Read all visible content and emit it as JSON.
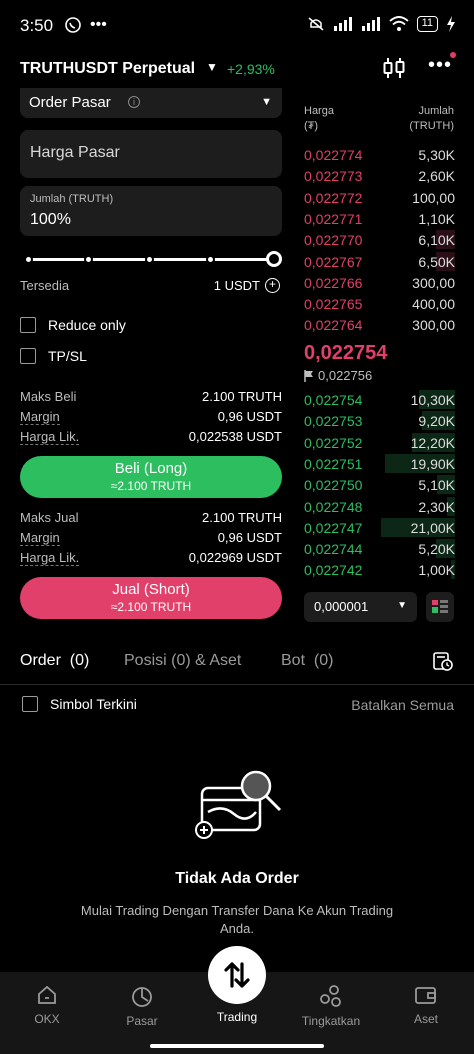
{
  "status_bar": {
    "time": "3:50",
    "battery": "11"
  },
  "header": {
    "pair": "TRUTHUSDT Perpetual",
    "change": "+2,93%"
  },
  "form": {
    "order_type": "Order Pasar",
    "price_placeholder": "Harga Pasar",
    "amount_label": "Jumlah (TRUTH)",
    "amount_value": "100%",
    "available_label": "Tersedia",
    "available_value": "1 USDT",
    "reduce_only": "Reduce only",
    "tpsl": "TP/SL",
    "buy_info": {
      "max_label": "Maks Beli",
      "max_value": "2.100 TRUTH",
      "margin_label": "Margin",
      "margin_value": "0,96 USDT",
      "liq_label": "Harga Lik.",
      "liq_value": "0,022538 USDT"
    },
    "buy_button": {
      "label": "Beli (Long)",
      "sub": "≈2.100 TRUTH"
    },
    "sell_info": {
      "max_label": "Maks Jual",
      "max_value": "2.100 TRUTH",
      "margin_label": "Margin",
      "margin_value": "0,96 USDT",
      "liq_label": "Harga Lik.",
      "liq_value": "0,022969 USDT"
    },
    "sell_button": {
      "label": "Jual (Short)",
      "sub": "≈2.100 TRUTH"
    }
  },
  "orderbook": {
    "price_header_1": "Harga",
    "price_header_2": "(₮)",
    "amount_header_1": "Jumlah",
    "amount_header_2": "(TRUTH)",
    "asks": [
      {
        "price": "0,022774",
        "amount": "5,30K",
        "depth": 0.0
      },
      {
        "price": "0,022773",
        "amount": "2,60K",
        "depth": 0.0
      },
      {
        "price": "0,022772",
        "amount": "100,00",
        "depth": 0.0
      },
      {
        "price": "0,022771",
        "amount": "1,10K",
        "depth": 0.0
      },
      {
        "price": "0,022770",
        "amount": "6,10K",
        "depth": 0.25
      },
      {
        "price": "0,022767",
        "amount": "6,50K",
        "depth": 0.25
      },
      {
        "price": "0,022766",
        "amount": "300,00",
        "depth": 0.0
      },
      {
        "price": "0,022765",
        "amount": "400,00",
        "depth": 0.0
      },
      {
        "price": "0,022764",
        "amount": "300,00",
        "depth": 0.0
      }
    ],
    "last_price": "0,022754",
    "mark_price": "0,022756",
    "bids": [
      {
        "price": "0,022754",
        "amount": "10,30K",
        "depth": 0.48
      },
      {
        "price": "0,022753",
        "amount": "9,20K",
        "depth": 0.44
      },
      {
        "price": "0,022752",
        "amount": "12,20K",
        "depth": 0.58
      },
      {
        "price": "0,022751",
        "amount": "19,90K",
        "depth": 0.95
      },
      {
        "price": "0,022750",
        "amount": "5,10K",
        "depth": 0.24
      },
      {
        "price": "0,022748",
        "amount": "2,30K",
        "depth": 0.11
      },
      {
        "price": "0,022747",
        "amount": "21,00K",
        "depth": 1.0
      },
      {
        "price": "0,022744",
        "amount": "5,20K",
        "depth": 0.25
      },
      {
        "price": "0,022742",
        "amount": "1,00K",
        "depth": 0.05
      }
    ],
    "precision": "0,000001"
  },
  "tabs": {
    "order": "Order",
    "order_count": "(0)",
    "positions": "Posisi (0) & Aset",
    "bot": "Bot",
    "bot_count": "(0)"
  },
  "orders": {
    "current_symbol": "Simbol Terkini",
    "cancel_all": "Batalkan Semua",
    "empty_title": "Tidak Ada Order",
    "empty_desc": "Mulai Trading Dengan Transfer Dana Ke Akun Trading Anda."
  },
  "nav": [
    {
      "label": "OKX",
      "icon": "home-icon"
    },
    {
      "label": "Pasar",
      "icon": "markets-icon"
    },
    {
      "label": "Trading",
      "icon": "trade-icon"
    },
    {
      "label": "Tingkatkan",
      "icon": "grow-icon"
    },
    {
      "label": "Aset",
      "icon": "wallet-icon"
    }
  ],
  "colors": {
    "buy": "#2dbe60",
    "sell": "#e0406a"
  }
}
